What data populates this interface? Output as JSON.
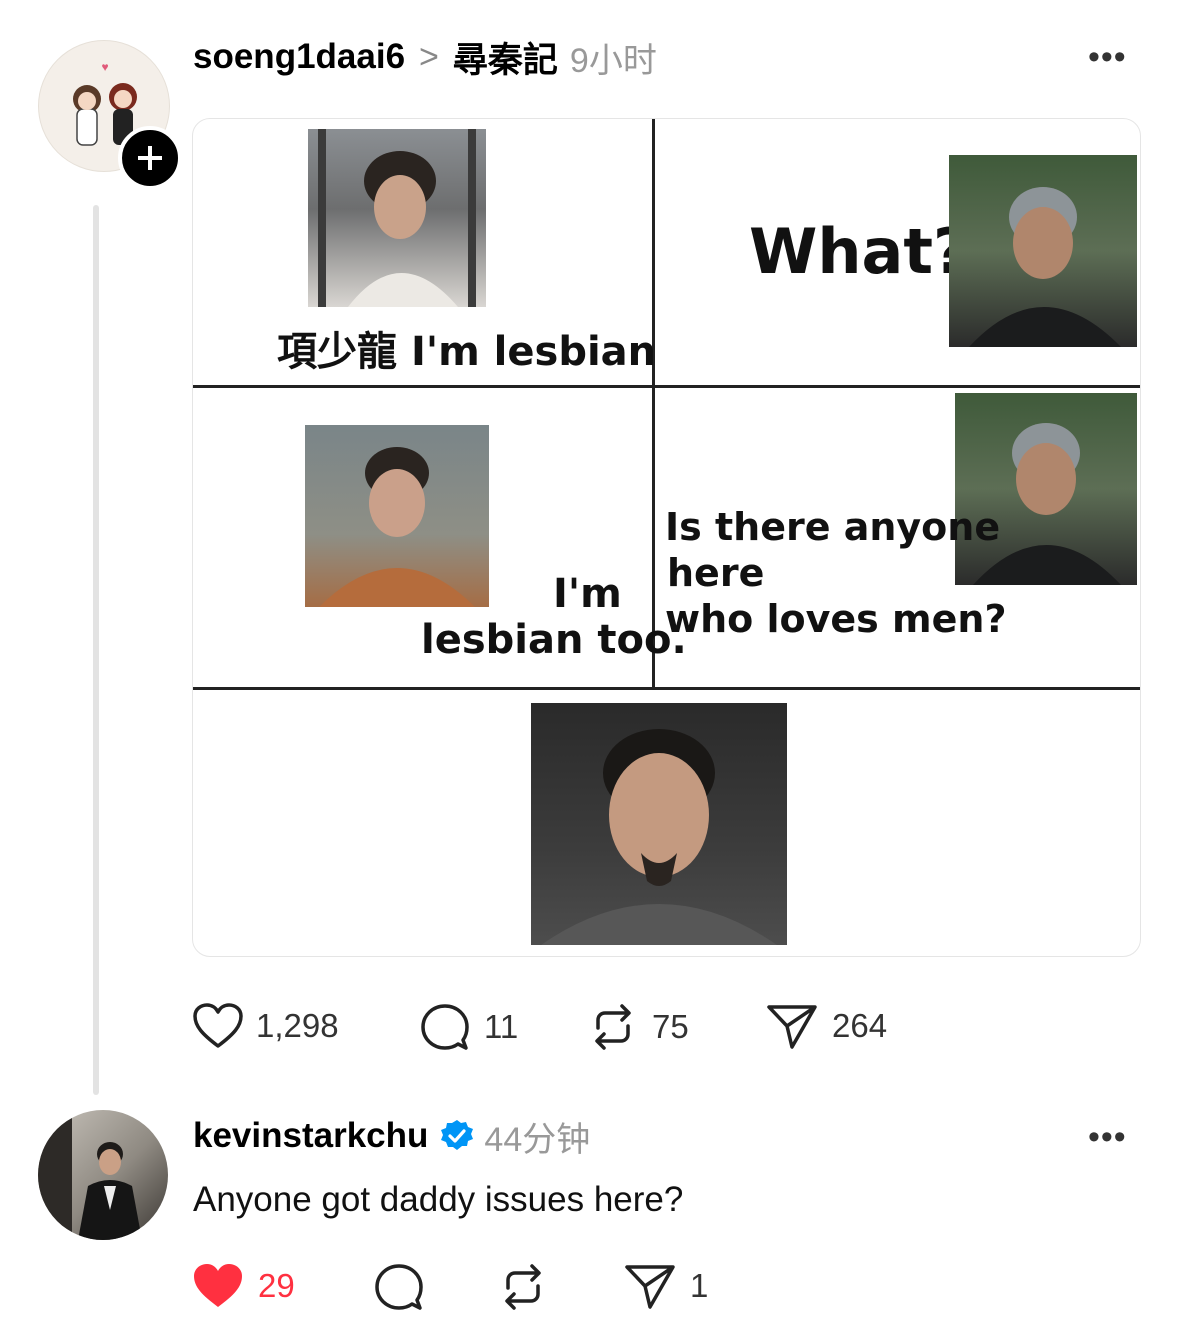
{
  "post": {
    "username": "soeng1daai6",
    "separator": ">",
    "topic_tag": "尋秦記",
    "time": "9小时",
    "more": "•••",
    "meme": {
      "panel1_name": "項少龍",
      "panel1_text": "I'm lesbian",
      "panel2_text": "What?",
      "panel3_line1": "I'm",
      "panel3_line2": "lesbian too.",
      "panel4_line1": "Is there anyone",
      "panel4_line2": "here",
      "panel4_line3": "who loves men?"
    },
    "stats": {
      "likes": "1,298",
      "replies": "11",
      "reposts": "75",
      "shares": "264"
    }
  },
  "reply": {
    "username": "kevinstarkchu",
    "time": "44分钟",
    "more": "•••",
    "text": "Anyone got daddy issues here?",
    "stats": {
      "likes": "29",
      "shares": "1"
    }
  },
  "colors": {
    "like_red": "#ff3040",
    "verified_blue": "#0095f6",
    "meta_gray": "#999999"
  }
}
